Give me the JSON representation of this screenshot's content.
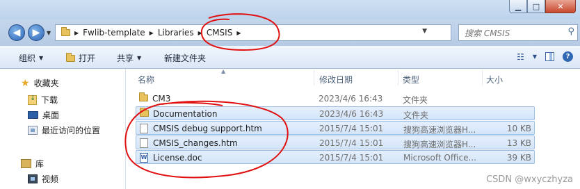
{
  "address": {
    "crumbs": [
      "Fwlib-template",
      "Libraries",
      "CMSIS"
    ],
    "search_placeholder": "搜索 CMSIS"
  },
  "toolbar": {
    "organize": "组织",
    "open": "打开",
    "share": "共享",
    "new_folder": "新建文件夹"
  },
  "sidebar": {
    "favorites": "收藏夹",
    "downloads": "下载",
    "desktop": "桌面",
    "recent": "最近访问的位置",
    "libraries": "库",
    "videos": "视频"
  },
  "columns": {
    "name": "名称",
    "modified": "修改日期",
    "type": "类型",
    "size": "大小"
  },
  "files": [
    {
      "name": "CM3",
      "modified": "2023/4/6 16:43",
      "type": "文件夹",
      "size": "",
      "icon": "folder-icon"
    },
    {
      "name": "Documentation",
      "modified": "2023/4/6 16:43",
      "type": "文件夹",
      "size": "",
      "icon": "folder-icon"
    },
    {
      "name": "CMSIS debug support.htm",
      "modified": "2015/7/4 15:01",
      "type": "搜狗高速浏览器H...",
      "size": "10 KB",
      "icon": "htm-file-icon"
    },
    {
      "name": "CMSIS_changes.htm",
      "modified": "2015/7/4 15:01",
      "type": "搜狗高速浏览器H...",
      "size": "13 KB",
      "icon": "htm-file-icon"
    },
    {
      "name": "License.doc",
      "modified": "2015/7/4 15:01",
      "type": "Microsoft Office...",
      "size": "39 KB",
      "icon": "word-doc-icon"
    }
  ],
  "watermark": "CSDN @wxyczhyza",
  "colors": {
    "annotation": "#e01010",
    "selection": "#d4e5fa"
  }
}
